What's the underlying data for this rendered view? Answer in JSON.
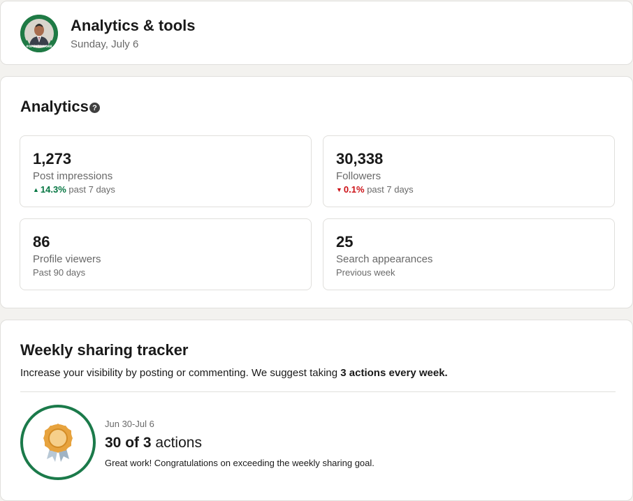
{
  "header": {
    "title": "Analytics & tools",
    "date": "Sunday, July 6",
    "avatar_badge_text": "#OPENTOWORK"
  },
  "analytics": {
    "title": "Analytics",
    "help_icon": "question-circle-icon",
    "metrics": [
      {
        "value": "1,273",
        "label": "Post impressions",
        "trend": {
          "direction": "up",
          "percent": "14.3%",
          "period": "past 7 days",
          "color": "#057642"
        }
      },
      {
        "value": "30,338",
        "label": "Followers",
        "trend": {
          "direction": "down",
          "percent": "0.1%",
          "period": "past 7 days",
          "color": "#cc1016"
        }
      },
      {
        "value": "86",
        "label": "Profile viewers",
        "subtitle": "Past 90 days"
      },
      {
        "value": "25",
        "label": "Search appearances",
        "subtitle": "Previous week"
      }
    ]
  },
  "tracker": {
    "title": "Weekly sharing tracker",
    "description_prefix": "Increase your visibility by posting or commenting. We suggest taking ",
    "description_bold": "3 actions every week.",
    "week_range": "Jun 30-Jul 6",
    "actions_done": "30",
    "actions_of": "of",
    "actions_goal": "3",
    "actions_word": "actions",
    "message": "Great work! Congratulations on exceeding the weekly sharing goal.",
    "badge_icon": "award-ribbon-icon"
  },
  "colors": {
    "background": "#f3f2ef",
    "card": "#ffffff",
    "positive": "#057642",
    "negative": "#cc1016",
    "ring": "#1b7a4a",
    "badge_gold": "#e7a33e"
  }
}
